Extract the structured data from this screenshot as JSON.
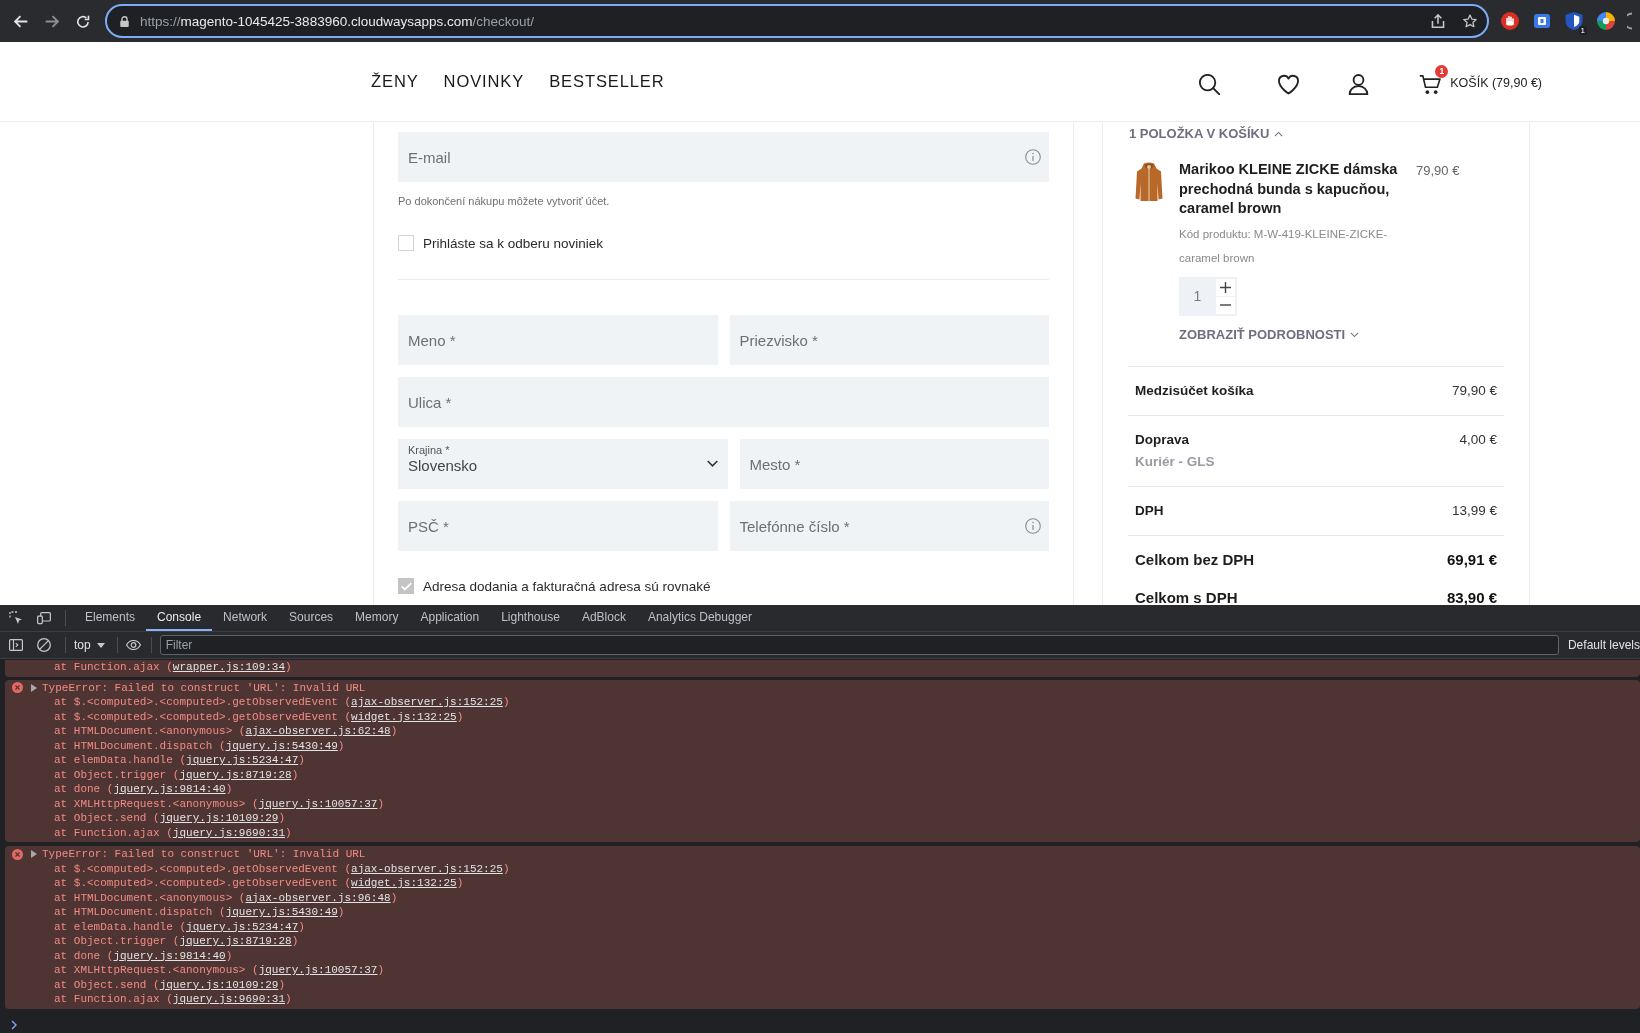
{
  "browser": {
    "url": {
      "scheme": "https://",
      "host": "magento-1045425-3883960.cloudwaysapps.com",
      "path": "/checkout/"
    },
    "extension_badge": "1"
  },
  "header": {
    "nav": [
      {
        "label": "ŽENY"
      },
      {
        "label": "NOVINKY"
      },
      {
        "label": "BESTSELLER"
      }
    ],
    "cart": {
      "count": "1",
      "label": "KOŠÍK (79,90 €)"
    }
  },
  "form": {
    "email": {
      "placeholder": "E-mail",
      "info": true
    },
    "email_note": "Po dokončení nákupu môžete vytvoriť účet.",
    "newsletter": {
      "label": "Prihláste sa k odberu noviniek",
      "checked": false
    },
    "rows": [
      {
        "fields": [
          {
            "kind": "text",
            "placeholder": "Meno *"
          },
          {
            "kind": "text",
            "placeholder": "Priezvisko *"
          }
        ]
      },
      {
        "fields": [
          {
            "kind": "text",
            "placeholder": "Ulica *"
          }
        ]
      },
      {
        "fields": [
          {
            "kind": "select",
            "label": "Krajina *",
            "value": "Slovensko"
          },
          {
            "kind": "text",
            "placeholder": "Mesto *"
          }
        ]
      },
      {
        "fields": [
          {
            "kind": "text",
            "placeholder": "PSČ *"
          },
          {
            "kind": "text",
            "placeholder": "Telefónne číslo *",
            "info": true
          }
        ]
      }
    ],
    "same_address": {
      "label": "Adresa dodania a fakturačná adresa sú rovnaké",
      "checked": true
    }
  },
  "sidebar": {
    "summary": {
      "label": "1 POLOŽKA V KOŠÍKU",
      "expanded": true
    },
    "item": {
      "name": "Marikoo KLEINE ZICKE dámska prechodná bunda s kapucňou, caramel brown",
      "price": "79,90 €",
      "code": "Kód produktu: M-W-419-KLEINE-ZICKE-caramel brown",
      "quantity": "1",
      "details": {
        "label": "ZOBRAZIŤ PODROBNOSTI",
        "expanded": false
      }
    },
    "totals": [
      {
        "label": "Medzisúčet košíka",
        "value": "79,90 €",
        "emphasis": false
      },
      {
        "label": "Doprava",
        "sub": "Kuriér - GLS",
        "value": "4,00 €",
        "emphasis": false
      },
      {
        "label": "DPH",
        "value": "13,99 €",
        "emphasis": false
      },
      {
        "label": "Celkom bez DPH",
        "value": "69,91 €",
        "emphasis": true
      },
      {
        "label": "Celkom s DPH",
        "value": "83,90 €",
        "emphasis": true
      }
    ]
  },
  "devtools": {
    "tabs": [
      {
        "label": "Elements",
        "selected": false
      },
      {
        "label": "Console",
        "selected": true
      },
      {
        "label": "Network",
        "selected": false
      },
      {
        "label": "Sources",
        "selected": false
      },
      {
        "label": "Memory",
        "selected": false
      },
      {
        "label": "Application",
        "selected": false
      },
      {
        "label": "Lighthouse",
        "selected": false
      },
      {
        "label": "AdBlock",
        "selected": false
      },
      {
        "label": "Analytics Debugger",
        "selected": false
      }
    ],
    "context": "top",
    "filter": {
      "placeholder": "Filter"
    },
    "levels": "Default levels",
    "console": [
      {
        "kind": "trace",
        "frames": [
          {
            "call": "at Function.ajax (",
            "link": "wrapper.js:109:34",
            "close": ")"
          }
        ]
      },
      {
        "kind": "error",
        "message": "TypeError: Failed to construct 'URL': Invalid URL",
        "frames": [
          {
            "call": "at $.<computed>.<computed>.getObservedEvent (",
            "link": "ajax-observer.js:152:25",
            "close": ")"
          },
          {
            "call": "at $.<computed>.<computed>.getObservedEvent (",
            "link": "widget.js:132:25",
            "close": ")"
          },
          {
            "call": "at HTMLDocument.<anonymous> (",
            "link": "ajax-observer.js:62:48",
            "close": ")"
          },
          {
            "call": "at HTMLDocument.dispatch (",
            "link": "jquery.js:5430:49",
            "close": ")"
          },
          {
            "call": "at elemData.handle (",
            "link": "jquery.js:5234:47",
            "close": ")"
          },
          {
            "call": "at Object.trigger (",
            "link": "jquery.js:8719:28",
            "close": ")"
          },
          {
            "call": "at done (",
            "link": "jquery.js:9814:40",
            "close": ")"
          },
          {
            "call": "at XMLHttpRequest.<anonymous> (",
            "link": "jquery.js:10057:37",
            "close": ")"
          },
          {
            "call": "at Object.send (",
            "link": "jquery.js:10109:29",
            "close": ")"
          },
          {
            "call": "at Function.ajax (",
            "link": "jquery.js:9690:31",
            "close": ")"
          }
        ]
      },
      {
        "kind": "error",
        "message": "TypeError: Failed to construct 'URL': Invalid URL",
        "frames": [
          {
            "call": "at $.<computed>.<computed>.getObservedEvent (",
            "link": "ajax-observer.js:152:25",
            "close": ")"
          },
          {
            "call": "at $.<computed>.<computed>.getObservedEvent (",
            "link": "widget.js:132:25",
            "close": ")"
          },
          {
            "call": "at HTMLDocument.<anonymous> (",
            "link": "ajax-observer.js:96:48",
            "close": ")"
          },
          {
            "call": "at HTMLDocument.dispatch (",
            "link": "jquery.js:5430:49",
            "close": ")"
          },
          {
            "call": "at elemData.handle (",
            "link": "jquery.js:5234:47",
            "close": ")"
          },
          {
            "call": "at Object.trigger (",
            "link": "jquery.js:8719:28",
            "close": ")"
          },
          {
            "call": "at done (",
            "link": "jquery.js:9814:40",
            "close": ")"
          },
          {
            "call": "at XMLHttpRequest.<anonymous> (",
            "link": "jquery.js:10057:37",
            "close": ")"
          },
          {
            "call": "at Object.send (",
            "link": "jquery.js:10109:29",
            "close": ")"
          },
          {
            "call": "at Function.ajax (",
            "link": "jquery.js:9690:31",
            "close": ")"
          }
        ]
      }
    ]
  }
}
